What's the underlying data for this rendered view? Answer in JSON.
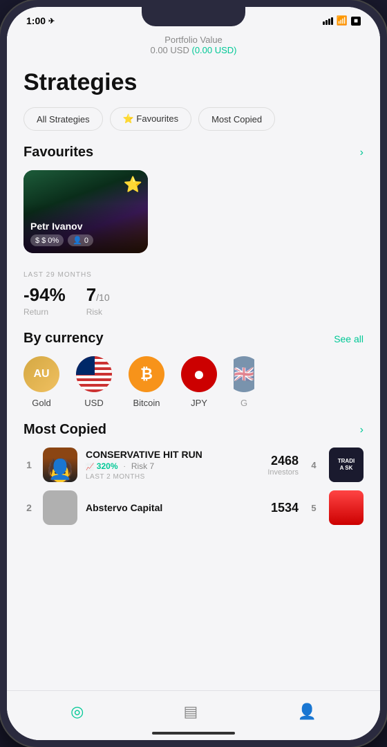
{
  "statusBar": {
    "time": "1:00",
    "timeIcon": "location-arrow"
  },
  "portfolio": {
    "label": "Portfolio Value",
    "value": "0.00 USD",
    "change": "(0.00 USD)"
  },
  "page": {
    "title": "Strategies"
  },
  "filterTabs": [
    {
      "id": "all",
      "label": "All Strategies",
      "active": false
    },
    {
      "id": "favourites",
      "label": "⭐ Favourites",
      "active": false
    },
    {
      "id": "most-copied",
      "label": "Most Copied",
      "active": false
    }
  ],
  "favourites": {
    "sectionTitle": "Favourites",
    "chevron": "›",
    "card": {
      "name": "Petr Ivanov",
      "returnBadge": "$ 0%",
      "followersBadge": "0",
      "star": "⭐"
    },
    "period": "LAST 29 MONTHS",
    "returnValue": "-94%",
    "returnLabel": "Return",
    "riskValue": "7",
    "riskSuffix": "/10",
    "riskLabel": "Risk"
  },
  "currency": {
    "sectionTitle": "By currency",
    "seeAll": "See all",
    "items": [
      {
        "id": "gold",
        "symbol": "AU",
        "label": "Gold",
        "type": "gold"
      },
      {
        "id": "usd",
        "symbol": "USD",
        "label": "USD",
        "type": "usd"
      },
      {
        "id": "bitcoin",
        "symbol": "₿",
        "label": "Bitcoin",
        "type": "bitcoin"
      },
      {
        "id": "jpy",
        "symbol": "●",
        "label": "JPY",
        "type": "jpy"
      },
      {
        "id": "gbp",
        "symbol": "🇬🇧",
        "label": "G",
        "type": "gbp"
      }
    ]
  },
  "mostCopied": {
    "sectionTitle": "Most Copied",
    "chevron": "›",
    "items": [
      {
        "rank": "1",
        "name": "CONSERVATIVE HIT RUN",
        "return": "320%",
        "risk": "Risk 7",
        "period": "LAST 2 MONTHS",
        "count": "2468",
        "countLabel": "Investors",
        "rankRight": "4",
        "avatarType": "person"
      },
      {
        "rank": "2",
        "name": "Abstervo Capital",
        "return": "",
        "risk": "",
        "period": "",
        "count": "1534",
        "countLabel": "",
        "rankRight": "5",
        "avatarType": "gray"
      }
    ]
  },
  "bottomNav": [
    {
      "id": "strategies",
      "icon": "◎",
      "active": true
    },
    {
      "id": "portfolio",
      "icon": "▤",
      "active": false
    },
    {
      "id": "profile",
      "icon": "👤",
      "active": false
    }
  ]
}
